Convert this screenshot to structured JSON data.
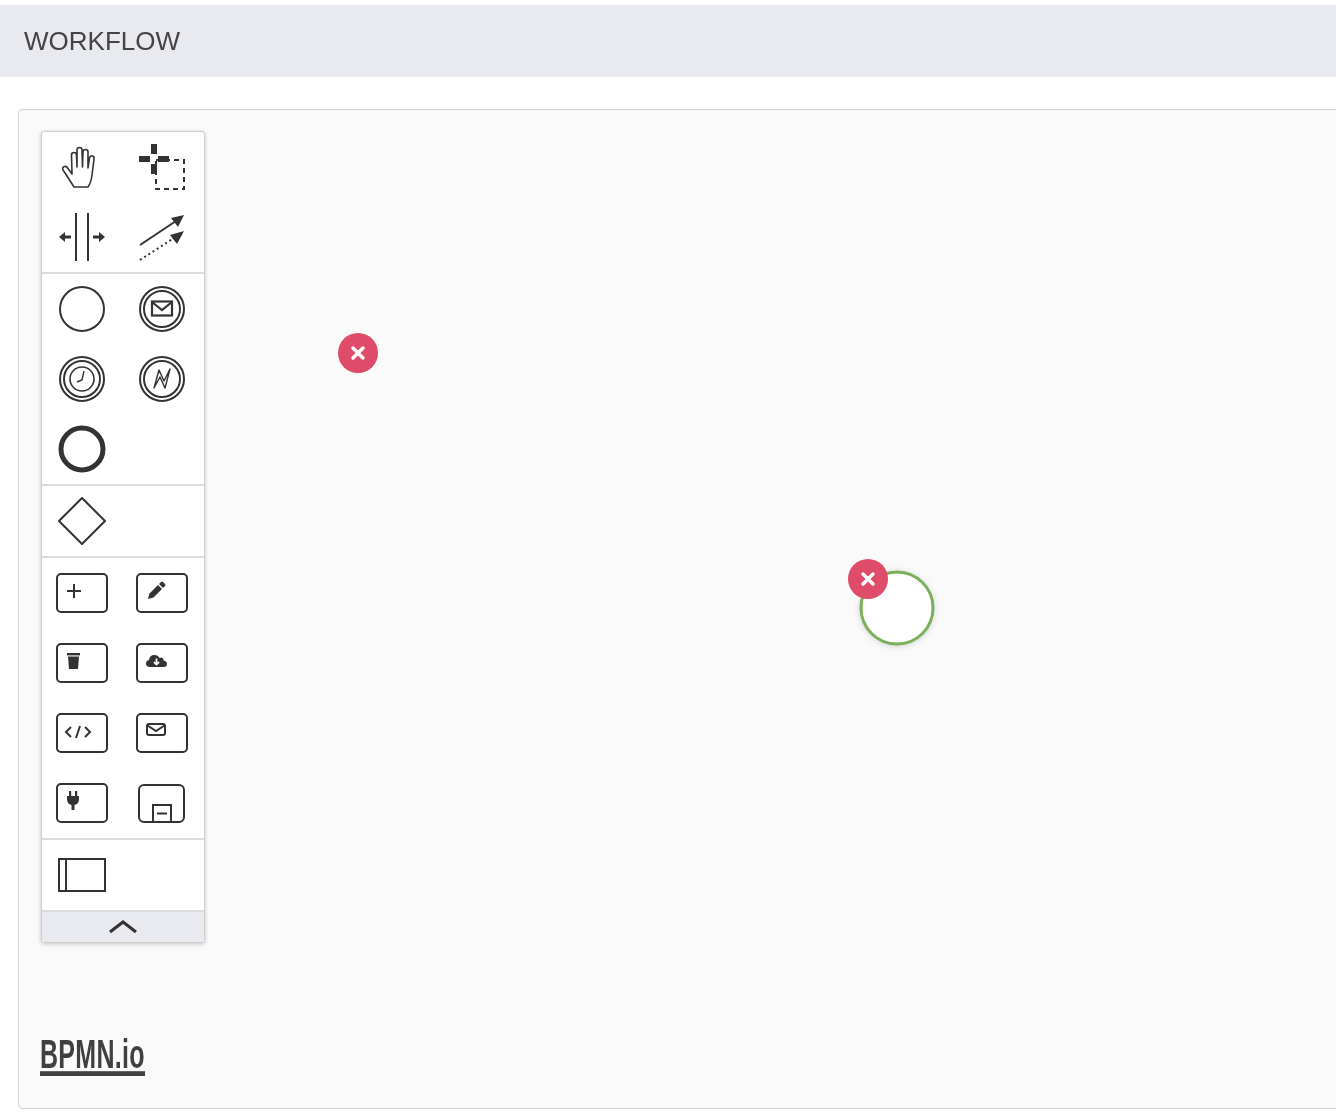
{
  "header": {
    "title": "WORKFLOW"
  },
  "palette": {
    "expanded": true,
    "groups": [
      {
        "entries": [
          {
            "kind": "hand"
          },
          {
            "kind": "lasso"
          },
          {
            "kind": "space"
          },
          {
            "kind": "connect"
          }
        ]
      },
      {
        "entries": [
          {
            "kind": "start-event"
          },
          {
            "kind": "message-event"
          },
          {
            "kind": "timer-event"
          },
          {
            "kind": "signal-event"
          },
          {
            "kind": "end-event"
          }
        ]
      },
      {
        "entries": [
          {
            "kind": "gateway"
          }
        ]
      },
      {
        "entries": [
          {
            "kind": "add-task"
          },
          {
            "kind": "edit-task"
          },
          {
            "kind": "delete-task"
          },
          {
            "kind": "download-task"
          },
          {
            "kind": "script-task"
          },
          {
            "kind": "mail-task"
          },
          {
            "kind": "plugin-task"
          },
          {
            "kind": "subprocess"
          }
        ]
      },
      {
        "entries": [
          {
            "kind": "pool"
          }
        ]
      }
    ]
  },
  "canvas": {
    "elements": [
      {
        "kind": "error-marker"
      },
      {
        "kind": "start-event",
        "error": true
      }
    ]
  },
  "logo": {
    "text": "BPMN.io"
  }
}
